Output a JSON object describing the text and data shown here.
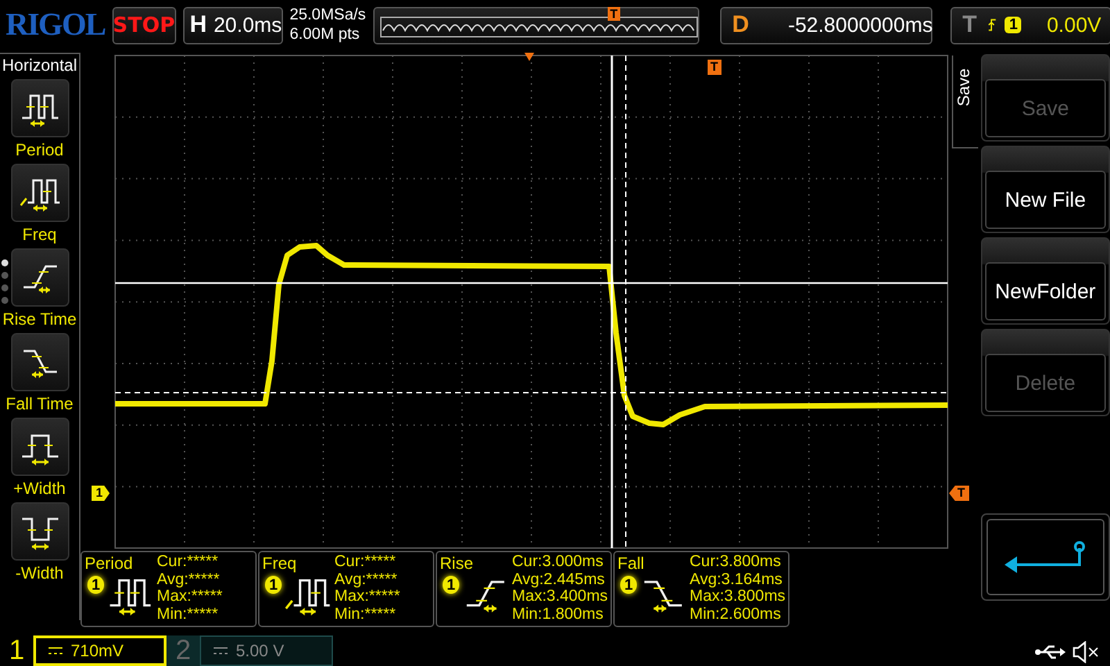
{
  "brand": "RIGOL",
  "run_state": "STOP",
  "timebase": {
    "label": "H",
    "value": "20.0ms"
  },
  "sample_rate": "25.0MSa/s",
  "memory_depth": "6.00M pts",
  "overview": {
    "trigger_marker": "T"
  },
  "delay": {
    "label": "D",
    "value": "-52.8000000ms"
  },
  "trigger": {
    "label": "T",
    "source": "1",
    "level": "0.00V"
  },
  "left_menu": {
    "title": "Horizontal",
    "items": [
      {
        "label": "Period",
        "kind": "period"
      },
      {
        "label": "Freq",
        "kind": "freq"
      },
      {
        "label": "Rise Time",
        "kind": "rise"
      },
      {
        "label": "Fall Time",
        "kind": "fall"
      },
      {
        "label": "+Width",
        "kind": "pwidth"
      },
      {
        "label": "-Width",
        "kind": "nwidth"
      }
    ],
    "pages": [
      {
        "selected": true
      },
      {
        "selected": false
      },
      {
        "selected": false
      },
      {
        "selected": false
      }
    ]
  },
  "markers": {
    "channel": "1",
    "trigger_level": "T",
    "trigger_position": "T"
  },
  "measurements": [
    {
      "name": "Period",
      "kind": "period",
      "source": "1",
      "rows": [
        "Cur:*****",
        "Avg:*****",
        "Max:*****",
        "Min:*****"
      ]
    },
    {
      "name": "Freq",
      "kind": "freq",
      "source": "1",
      "rows": [
        "Cur:*****",
        "Avg:*****",
        "Max:*****",
        "Min:*****"
      ]
    },
    {
      "name": "Rise",
      "kind": "rise",
      "source": "1",
      "rows": [
        "Cur:3.000ms",
        "Avg:2.445ms",
        "Max:3.400ms",
        "Min:1.800ms"
      ]
    },
    {
      "name": "Fall",
      "kind": "fall",
      "source": "1",
      "rows": [
        "Cur:3.800ms",
        "Avg:3.164ms",
        "Max:3.800ms",
        "Min:2.600ms"
      ]
    }
  ],
  "right_menu": {
    "title": "Save",
    "buttons": [
      {
        "label": "Save",
        "disabled": true
      },
      {
        "label": "New File",
        "disabled": false
      },
      {
        "label": "NewFolder",
        "disabled": false
      },
      {
        "label": "Delete",
        "disabled": true
      }
    ]
  },
  "channels": [
    {
      "number": "1",
      "scale": "710mV",
      "selected": true
    },
    {
      "number": "2",
      "scale": "5.00 V",
      "selected": false
    }
  ]
}
